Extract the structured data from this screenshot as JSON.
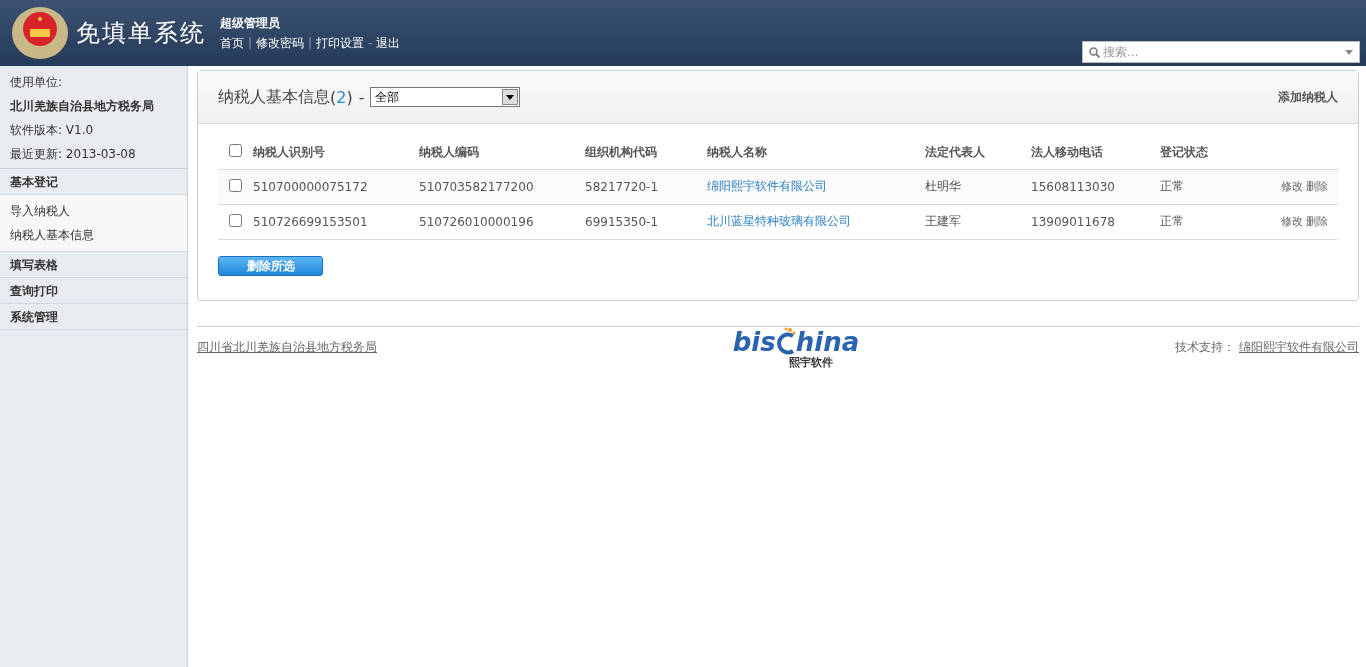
{
  "header": {
    "title": "免填单系统",
    "user": "超级管理员",
    "nav": [
      {
        "label": "首页",
        "separator": "|"
      },
      {
        "label": "修改密码",
        "separator": "|"
      },
      {
        "label": "打印设置",
        "separator": "-"
      },
      {
        "label": "退出"
      }
    ],
    "search": {
      "placeholder": "搜索..."
    }
  },
  "sidebar": {
    "info": [
      {
        "text": "使用单位:",
        "kind": "label"
      },
      {
        "text": "北川羌族自治县地方税务局",
        "kind": "unit"
      },
      {
        "text": "软件版本: V1.0",
        "kind": "label"
      },
      {
        "text": "最近更新: 2013-03-08",
        "kind": "label"
      }
    ],
    "menu": [
      {
        "label": "基本登记",
        "children": [
          {
            "label": "导入纳税人"
          },
          {
            "label": "纳税人基本信息"
          }
        ]
      },
      {
        "label": "填写表格"
      },
      {
        "label": "查询打印"
      },
      {
        "label": "系统管理"
      }
    ]
  },
  "panel": {
    "title": "纳税人基本信息",
    "paren_open": "(",
    "count": "2",
    "paren_close": ")",
    "dash": "-",
    "filter": "全部",
    "add_link": "添加纳税人",
    "table": {
      "select_all": {
        "checked": false
      },
      "columns": [
        "纳税人识别号",
        "纳税人编码",
        "组织机构代码",
        "纳税人名称",
        "法定代表人",
        "法人移动电话",
        "登记状态"
      ],
      "rows": [
        {
          "checked": false,
          "cells": [
            "510700000075172",
            "510703582177200",
            "58217720-1",
            "绵阳熙宇软件有限公司",
            "杜明华",
            "15608113030",
            "正常"
          ],
          "actions": [
            "修改",
            "删除"
          ]
        },
        {
          "checked": false,
          "cells": [
            "510726699153501",
            "510726010000196",
            "69915350-1",
            "北川蓝星特种玻璃有限公司",
            "王建军",
            "13909011678",
            "正常"
          ],
          "actions": [
            "修改",
            "删除"
          ]
        }
      ]
    },
    "delete_button": "删除所选"
  },
  "footer": {
    "left_link": "四川省北川羌族自治县地方税务局",
    "logo": {
      "left": "bis",
      "right": "hina",
      "sub": "熙宇软件"
    },
    "support_label": "技术支持：",
    "support_link": "绵阳熙宇软件有限公司"
  }
}
